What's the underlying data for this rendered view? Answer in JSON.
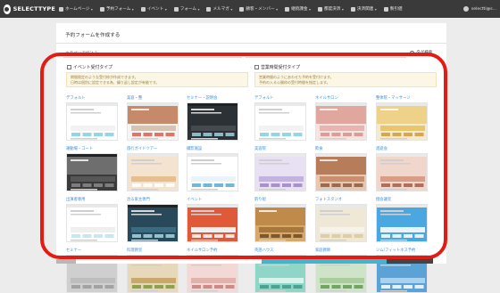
{
  "app": {
    "name": "SELECTTYPE"
  },
  "nav": {
    "items": [
      {
        "label": "ホームページ",
        "caret": true
      },
      {
        "label": "予約フォーム",
        "caret": true
      },
      {
        "label": "イベント",
        "caret": true
      },
      {
        "label": "フォーム",
        "caret": true
      },
      {
        "label": "メルマガ",
        "caret": true
      },
      {
        "label": "顧客・メンバー",
        "caret": true
      },
      {
        "label": "継続課金",
        "caret": true
      },
      {
        "label": "都度決済",
        "caret": true
      },
      {
        "label": "決済関連",
        "caret": true
      },
      {
        "label": "製引値",
        "caret": false
      }
    ],
    "user": "selectti@s...",
    "caret_glyph": "▾"
  },
  "page": {
    "title": "予約フォームを作成する",
    "filter_placeholder": "カテゴリで絞込み",
    "filter_caret": "▾",
    "search_label": "タグ検索"
  },
  "sections": [
    {
      "title": "イベント受付タイプ",
      "note_lines": [
        "期間限定のような受付枠が作成できます。",
        "日時は個別に設定できる為、繰り返し設定が有能です。"
      ],
      "templates": [
        {
          "label": "デフォルト",
          "theme": "default"
        },
        {
          "label": "美容・整",
          "theme": "beauty"
        },
        {
          "label": "セミナー・説明会",
          "theme": "seminar"
        },
        {
          "label": "運動場・コート",
          "theme": "court"
        },
        {
          "label": "旅行ガイドツアー",
          "theme": "tour"
        },
        {
          "label": "撮影施設",
          "theme": "studio"
        },
        {
          "label": "出演者専用",
          "theme": "plain"
        },
        {
          "label": "治る家主専門",
          "theme": "teal"
        },
        {
          "label": "イベント",
          "theme": "event"
        },
        {
          "label": "セミナー",
          "theme": "seminar2"
        },
        {
          "label": "料理教室",
          "theme": "cooking"
        },
        {
          "label": "ネイルサロン予約",
          "theme": "nail2"
        }
      ]
    },
    {
      "title": "営業時間受付タイプ",
      "note_lines": [
        "営業時間のようにあわせた予約を受付けます。",
        "予約の入る公開枠の受付時間を指定します。"
      ],
      "templates": [
        {
          "label": "デフォルト",
          "theme": "default"
        },
        {
          "label": "ネイルサロン",
          "theme": "nail"
        },
        {
          "label": "整体院・マッサージ",
          "theme": "massage"
        },
        {
          "label": "美容院",
          "theme": "hair"
        },
        {
          "label": "飲食",
          "theme": "food"
        },
        {
          "label": "酒遊会",
          "theme": "party"
        },
        {
          "label": "釣り船",
          "theme": "fishing"
        },
        {
          "label": "フォトスタジオ",
          "theme": "photo"
        },
        {
          "label": "個会議室",
          "theme": "meeting"
        },
        {
          "label": "英語ハウス",
          "theme": "english"
        },
        {
          "label": "家庭教師",
          "theme": "tutor"
        },
        {
          "label": "ジム/フィットネス予約",
          "theme": "gym"
        }
      ]
    }
  ],
  "colors": {
    "topbar": "#3a3a3a",
    "link": "#3a8fd6",
    "highlight": "#e41b12",
    "note_bg": "#fcf7e4",
    "note_text": "#9a7f35"
  }
}
